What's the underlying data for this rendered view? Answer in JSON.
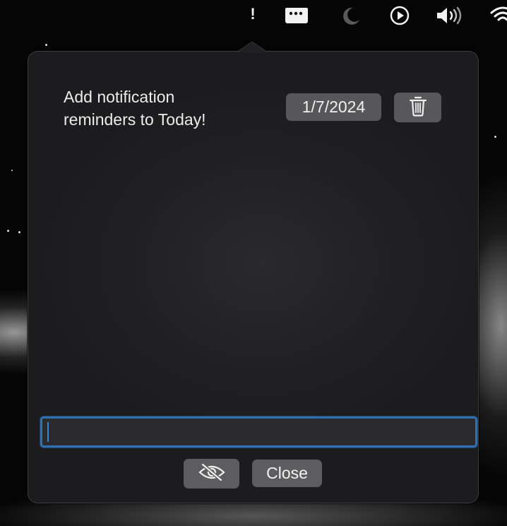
{
  "menubar": {
    "alert_glyph": "!",
    "icons": [
      "alert-icon",
      "window-icon",
      "moon-icon",
      "play-icon",
      "volume-icon",
      "wifi-icon"
    ]
  },
  "popover": {
    "reminder": {
      "text": "Add notification\nreminders to Today!",
      "date": "1/7/2024"
    },
    "input": {
      "value": "",
      "placeholder": ""
    },
    "buttons": {
      "close_label": "Close"
    }
  },
  "colors": {
    "accent": "#2f6fb4",
    "popover_bg": "#202022",
    "button_bg": "#5d5d60"
  }
}
